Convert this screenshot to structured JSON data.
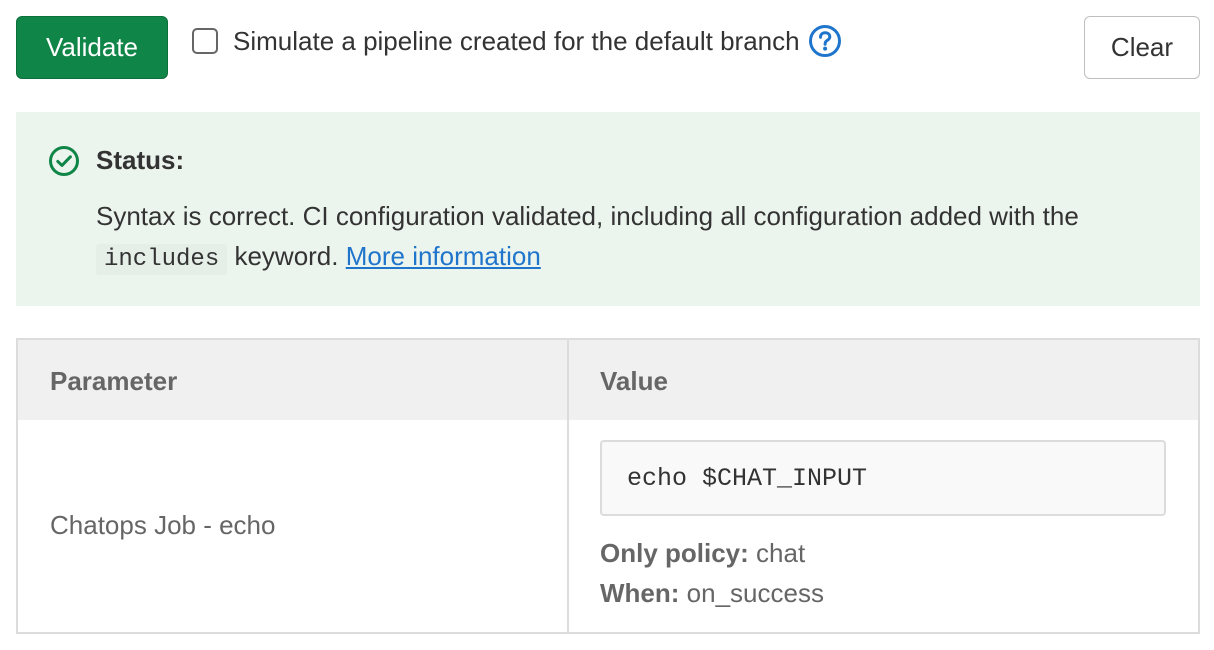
{
  "toolbar": {
    "validate_label": "Validate",
    "simulate_label": "Simulate a pipeline created for the default branch",
    "simulate_checked": false,
    "help_icon": "question-circle-icon",
    "clear_label": "Clear"
  },
  "status": {
    "icon": "check-circle-icon",
    "title": "Status:",
    "message_before": "Syntax is correct. CI configuration validated, including all configuration added with the",
    "code": "includes",
    "message_after": "keyword.",
    "link_text": "More information",
    "colors": {
      "background": "#ecf4ee",
      "success": "#108548",
      "link": "#1f75cb"
    }
  },
  "table": {
    "headers": {
      "parameter": "Parameter",
      "value": "Value"
    },
    "rows": [
      {
        "parameter": "Chatops Job - echo",
        "script": "echo $CHAT_INPUT",
        "only_policy_label": "Only policy:",
        "only_policy_value": "chat",
        "when_label": "When:",
        "when_value": "on_success"
      }
    ]
  }
}
